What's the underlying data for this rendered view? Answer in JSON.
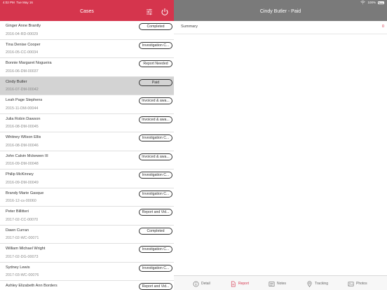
{
  "status_bar": {
    "time": "4:02 PM",
    "date": "Tue May 16",
    "battery": "100%"
  },
  "left": {
    "title": "Cases",
    "cases": [
      {
        "name": "Ginger Anne Brantly",
        "id": "2016-04-RD-00029",
        "status": "Completed"
      },
      {
        "name": "Tina Denise Cooper",
        "id": "2016-05-CC-00034",
        "status": "Investigation C..."
      },
      {
        "name": "Bonnie Margaret Nogueira",
        "id": "2016-06-DM-00037",
        "status": "Report Needed"
      },
      {
        "name": "Cindy Butler",
        "id": "2016-07-DM-00042",
        "status": "Paid"
      },
      {
        "name": "Leah Page Stephens",
        "id": "2015-11-DM-00044",
        "status": "Invoiced & awa..."
      },
      {
        "name": "Julia Robin Dawson",
        "id": "2016-08-DM-00045",
        "status": "Invoiced & awa..."
      },
      {
        "name": "Whitney Wilson Ellis",
        "id": "2016-08-DM-00046",
        "status": "Investigation C..."
      },
      {
        "name": "John Calvin Mckewen III",
        "id": "2016-09-DM-00048",
        "status": "Invoiced & awa..."
      },
      {
        "name": "Philip McKinney",
        "id": "2016-09-DM-00049",
        "status": "Investigation C..."
      },
      {
        "name": "Brandy Marie Gasque",
        "id": "2016-12-cs-00060",
        "status": "Investigation C..."
      },
      {
        "name": "Peter Billitteri",
        "id": "2017-02-CC-00070",
        "status": "Report and Vid..."
      },
      {
        "name": "Dawn Curran",
        "id": "2017-02-WC-00071",
        "status": "Completed"
      },
      {
        "name": "William Michael Wright",
        "id": "2017-02-DG-00073",
        "status": "Investigation C..."
      },
      {
        "name": "Sydney Lewis",
        "id": "2017-03-WC-00076",
        "status": "Investigation C..."
      },
      {
        "name": "Ashley Elizabeth Ann Borders",
        "id": "",
        "status": "Report and Vid..."
      }
    ]
  },
  "right": {
    "title": "Cindy Butler - Paid",
    "summary_label": "Summary",
    "summary_count": "0",
    "tabs": [
      {
        "label": "Detail",
        "icon": "info-icon"
      },
      {
        "label": "Report",
        "icon": "document-icon"
      },
      {
        "label": "Notes",
        "icon": "notes-icon"
      },
      {
        "label": "Tracking",
        "icon": "location-pin-icon"
      },
      {
        "label": "Photos",
        "icon": "photos-icon"
      }
    ]
  },
  "colors": {
    "accent": "#d5354d",
    "header_gray": "#7a7a7a",
    "selected_row": "#d3d3d3"
  }
}
